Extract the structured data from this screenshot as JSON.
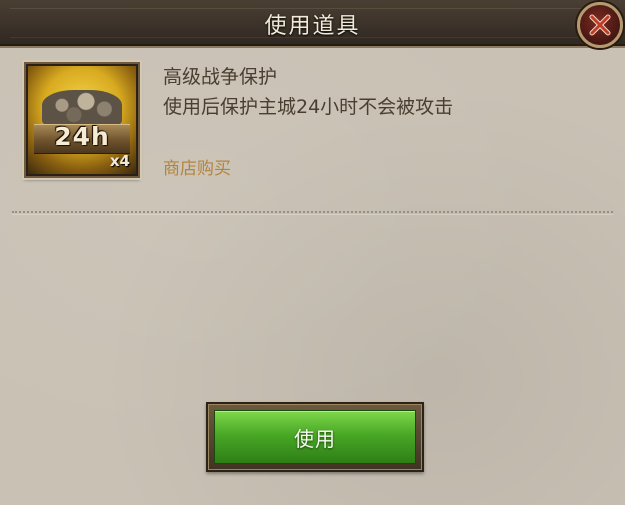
{
  "dialog": {
    "title": "使用道具"
  },
  "item": {
    "name": "高级战争保护",
    "description": "使用后保护主城24小时不会被攻击",
    "duration_label": "24h",
    "count_label": "x4",
    "icon": "war-protection-shield-icon"
  },
  "links": {
    "shop_buy": "商店购买"
  },
  "actions": {
    "use_label": "使用"
  },
  "colors": {
    "title_bar": "#3b3229",
    "panel": "#c9c1b4",
    "text": "#4a3e30",
    "link": "#b38440",
    "button_green": "#49a826",
    "close_red": "#7a2a20"
  }
}
